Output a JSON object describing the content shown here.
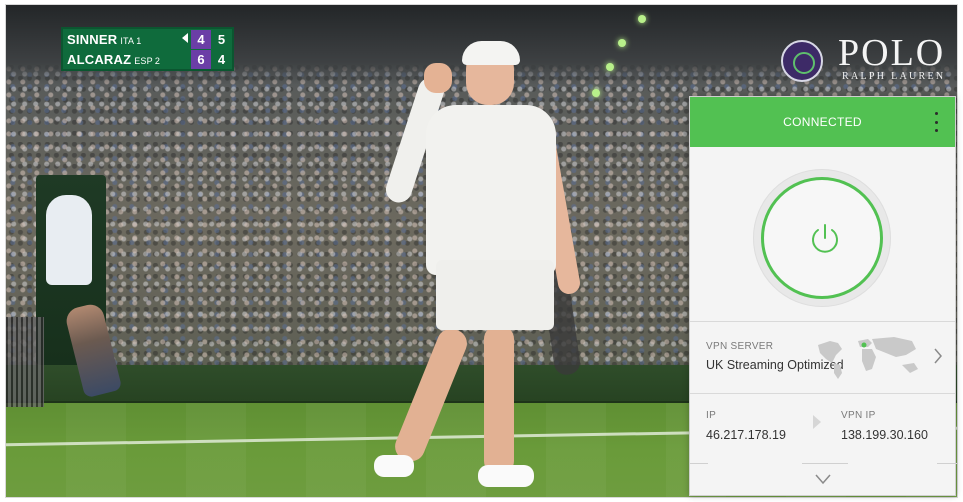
{
  "scoreboard": {
    "player1": {
      "name": "SINNER",
      "country": "ITA",
      "seed": "1",
      "set1": "4",
      "set2": "5",
      "serving": true
    },
    "player2": {
      "name": "ALCARAZ",
      "country": "ESP",
      "seed": "2",
      "set1": "6",
      "set2": "4",
      "serving": false
    },
    "serve_icon": "serve-indicator-icon",
    "colors": {
      "background": "#0f6b3c",
      "highlight": "#6b3ea6"
    }
  },
  "sponsor": {
    "emblem_icon": "wimbledon-emblem-icon",
    "brand": "POLO",
    "sub": "RALPH LAUREN"
  },
  "vpn": {
    "status": "CONNECTED",
    "menu_icon": "kebab-menu-icon",
    "power_icon": "power-icon",
    "server": {
      "caption": "VPN SERVER",
      "name": "UK Streaming Optimized",
      "map_icon": "world-map-icon",
      "chevron_icon": "chevron-right-icon"
    },
    "ip": {
      "caption": "IP",
      "value": "46.217.178.19"
    },
    "vpn_ip": {
      "caption": "VPN IP",
      "value": "138.199.30.160"
    },
    "arrow_icon": "arrow-right-icon",
    "expand_icon": "chevron-down-icon",
    "colors": {
      "accent": "#52c152",
      "panel": "#f4f4f4"
    }
  }
}
